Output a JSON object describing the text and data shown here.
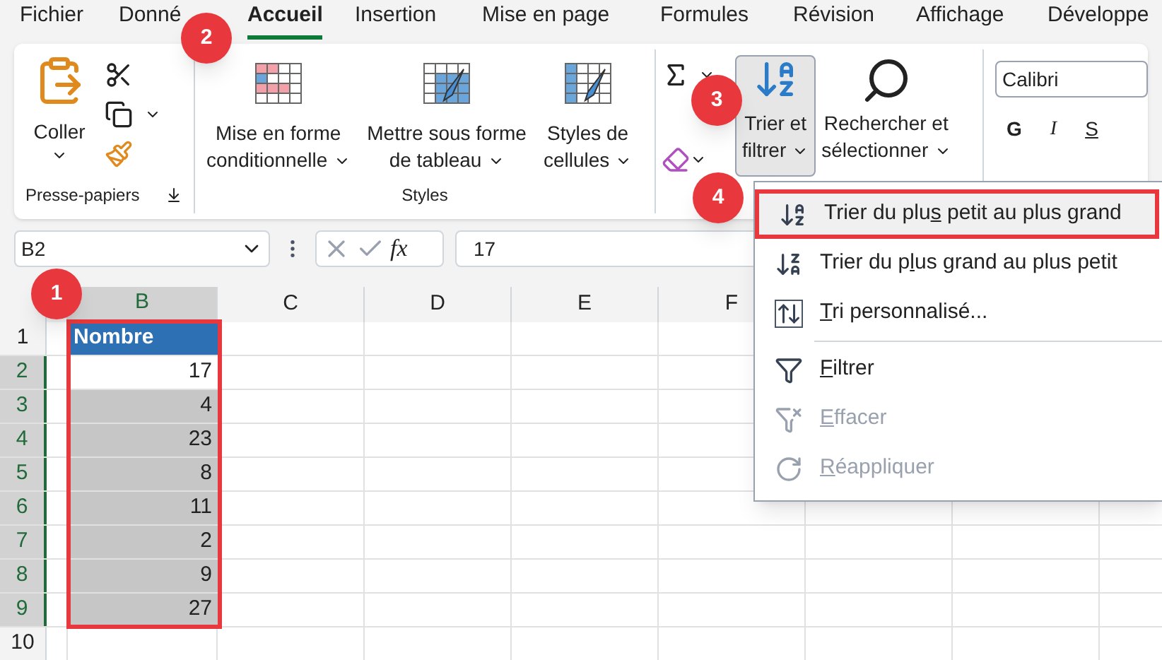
{
  "menu_tabs": [
    {
      "label": "Fichier",
      "selected": false
    },
    {
      "label": "Donné",
      "selected": false
    },
    {
      "label": "Accueil",
      "selected": true
    },
    {
      "label": "Insertion",
      "selected": false
    },
    {
      "label": "Mise en page",
      "selected": false
    },
    {
      "label": "Formules",
      "selected": false
    },
    {
      "label": "Révision",
      "selected": false
    },
    {
      "label": "Affichage",
      "selected": false
    },
    {
      "label": "Développe",
      "selected": false
    }
  ],
  "ribbon": {
    "clipboard": {
      "paste_label": "Coller",
      "group_label": "Presse-papiers"
    },
    "styles": {
      "buttons": [
        {
          "kind": "conditional",
          "lines": [
            "Mise en forme",
            "conditionnelle"
          ]
        },
        {
          "kind": "table",
          "lines": [
            "Mettre sous forme",
            "de tableau"
          ]
        },
        {
          "kind": "cell",
          "lines": [
            "Styles de",
            "cellules"
          ]
        }
      ],
      "group_label": "Styles"
    },
    "editing": {
      "sort_filter": {
        "lines": [
          "Trier et",
          "filtrer"
        ],
        "pressed": true
      },
      "find": {
        "lines": [
          "Rechercher et",
          "sélectionner"
        ]
      }
    },
    "font": {
      "font_name": "Calibri",
      "format_buttons": [
        {
          "kind": "bold",
          "label": "G"
        },
        {
          "kind": "italic",
          "label": "I"
        },
        {
          "kind": "underline",
          "label": "S"
        }
      ]
    }
  },
  "formula_bar": {
    "name_box": "B2",
    "fx": "fx",
    "value": "17"
  },
  "sheet": {
    "columns": [
      {
        "label": "B",
        "selected": true
      },
      {
        "label": "C",
        "selected": false
      },
      {
        "label": "D",
        "selected": false
      },
      {
        "label": "E",
        "selected": false
      },
      {
        "label": "F",
        "selected": false
      }
    ],
    "rows": [
      {
        "number": "1",
        "selected": false,
        "value": "Nombre",
        "kind": "header"
      },
      {
        "number": "2",
        "selected": true,
        "value": "17",
        "kind": "active"
      },
      {
        "number": "3",
        "selected": true,
        "value": "4",
        "kind": "selected"
      },
      {
        "number": "4",
        "selected": true,
        "value": "23",
        "kind": "selected"
      },
      {
        "number": "5",
        "selected": true,
        "value": "8",
        "kind": "selected"
      },
      {
        "number": "6",
        "selected": true,
        "value": "11",
        "kind": "selected"
      },
      {
        "number": "7",
        "selected": true,
        "value": "2",
        "kind": "selected"
      },
      {
        "number": "8",
        "selected": true,
        "value": "9",
        "kind": "selected"
      },
      {
        "number": "9",
        "selected": true,
        "value": "27",
        "kind": "selected"
      },
      {
        "number": "10",
        "selected": false,
        "kind": "empty"
      }
    ],
    "range_outlined": true
  },
  "dropdown": {
    "items": [
      {
        "kind": "sort-asc",
        "before": "Trier du plu",
        "accel": "s",
        "after": " petit au plus grand",
        "disabled": false,
        "highlighted": true
      },
      {
        "kind": "sort-desc",
        "before": "Trier du p",
        "accel": "l",
        "after": "us grand au plus petit",
        "disabled": false,
        "highlighted": false
      },
      {
        "kind": "custom",
        "accel": "T",
        "after": "ri personnalisé...",
        "disabled": false,
        "highlighted": false
      },
      {
        "kind": "filter",
        "accel": "F",
        "after": "iltrer",
        "disabled": false,
        "highlighted": false
      },
      {
        "kind": "clear",
        "accel": "E",
        "after": "ffacer",
        "disabled": true,
        "highlighted": false
      },
      {
        "kind": "reapply",
        "accel": "R",
        "after": "éappliquer",
        "disabled": true,
        "highlighted": false
      }
    ]
  },
  "badges": [
    {
      "label": "1"
    },
    {
      "label": "2"
    },
    {
      "label": "3"
    },
    {
      "label": "4"
    }
  ]
}
